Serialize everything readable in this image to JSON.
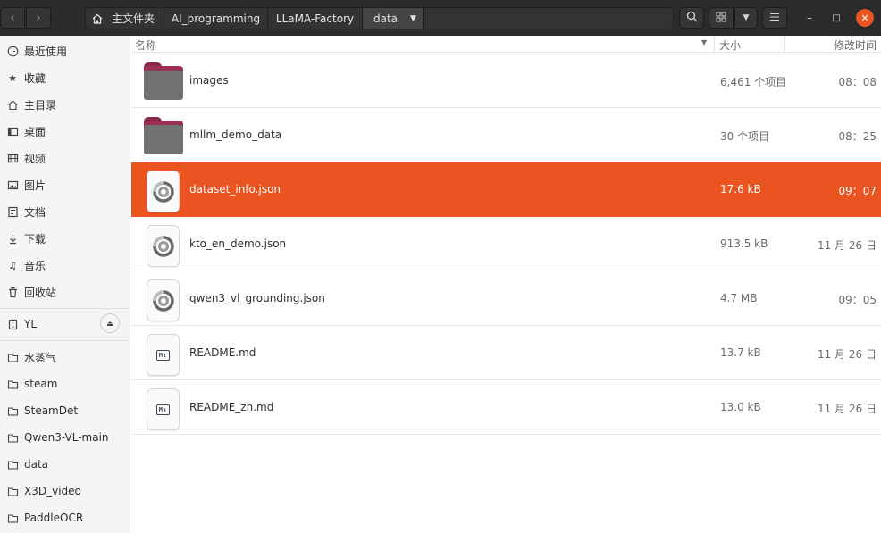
{
  "header": {
    "breadcrumbs": [
      "主文件夹",
      "AI_programming",
      "LLaMA-Factory",
      "data"
    ]
  },
  "sidebar": {
    "places": [
      {
        "label": "最近使用",
        "icon": "clock-icon"
      },
      {
        "label": "收藏",
        "icon": "star-icon"
      },
      {
        "label": "主目录",
        "icon": "home-icon"
      },
      {
        "label": "桌面",
        "icon": "desktop-icon"
      },
      {
        "label": "视频",
        "icon": "video-icon"
      },
      {
        "label": "图片",
        "icon": "image-icon"
      },
      {
        "label": "文档",
        "icon": "document-icon"
      },
      {
        "label": "下载",
        "icon": "download-icon"
      },
      {
        "label": "音乐",
        "icon": "music-icon"
      },
      {
        "label": "回收站",
        "icon": "trash-icon"
      }
    ],
    "device": {
      "label": "YL",
      "icon": "usb-drive-icon"
    },
    "bookmarks": [
      {
        "label": "水蒸气",
        "icon": "folder-icon"
      },
      {
        "label": "steam",
        "icon": "folder-icon"
      },
      {
        "label": "SteamDet",
        "icon": "folder-icon"
      },
      {
        "label": "Qwen3-VL-main",
        "icon": "folder-icon"
      },
      {
        "label": "data",
        "icon": "folder-icon"
      },
      {
        "label": "X3D_video",
        "icon": "folder-icon"
      },
      {
        "label": "PaddleOCR",
        "icon": "folder-icon"
      }
    ]
  },
  "list": {
    "columns": {
      "name": "名称",
      "size": "大小",
      "modified": "修改时间"
    },
    "rows": [
      {
        "name": "images",
        "size": "6,461 个项目",
        "modified": "08：08",
        "type": "folder",
        "selected": false
      },
      {
        "name": "mllm_demo_data",
        "size": "30 个项目",
        "modified": "08：25",
        "type": "folder",
        "selected": false
      },
      {
        "name": "dataset_info.json",
        "size": "17.6 kB",
        "modified": "09：07",
        "type": "json",
        "selected": true
      },
      {
        "name": "kto_en_demo.json",
        "size": "913.5 kB",
        "modified": "11 月 26 日",
        "type": "json",
        "selected": false
      },
      {
        "name": "qwen3_vl_grounding.json",
        "size": "4.7 MB",
        "modified": "09：05",
        "type": "json",
        "selected": false
      },
      {
        "name": "README.md",
        "size": "13.7 kB",
        "modified": "11 月 26 日",
        "type": "markdown",
        "selected": false
      },
      {
        "name": "README_zh.md",
        "size": "13.0 kB",
        "modified": "11 月 26 日",
        "type": "markdown",
        "selected": false
      }
    ]
  },
  "colors": {
    "accent": "#e95420",
    "headerbar": "#2b2b2b",
    "folder": "#727272",
    "folder_tab": "#9b2f51"
  }
}
